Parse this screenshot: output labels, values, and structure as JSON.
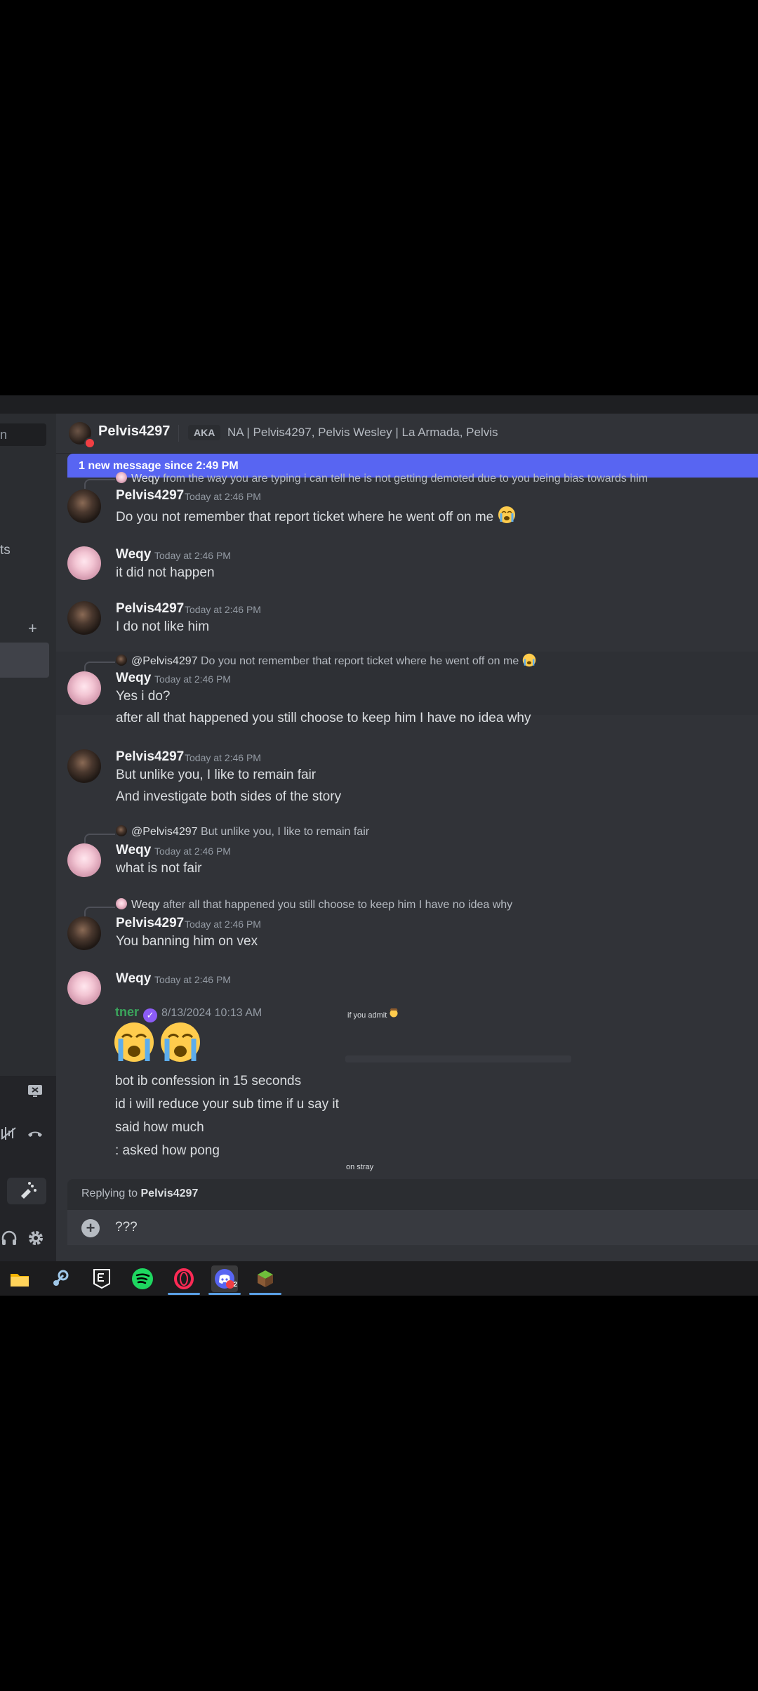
{
  "sidebar": {
    "search_fragment": "n",
    "channel_fragment": "ts",
    "plus_label": "+"
  },
  "header": {
    "name": "Pelvis4297",
    "aka_label": "AKA",
    "aka_names": "NA | Pelvis4297, Pelvis Wesley | La Armada, Pelvis"
  },
  "new_messages_bar": "1 new message since 2:49 PM",
  "messages": [
    {
      "reply_user": "Weqy",
      "reply_text": "from the way you are typing i can tell he is not getting demoted due to you being bias towards him",
      "author": "Pelvis4297",
      "time": "Today at 2:46 PM",
      "text": "Do you not remember that report ticket where he went off on me"
    },
    {
      "author": "Weqy",
      "time": "Today at 2:46 PM",
      "text": "it did not happen"
    },
    {
      "author": "Pelvis4297",
      "time": "Today at 2:46 PM",
      "text": "I do not like him"
    },
    {
      "reply_user": "@Pelvis4297",
      "reply_text": "Do you not remember that report ticket where he went off on me",
      "author": "Weqy",
      "time": "Today at 2:46 PM",
      "text": "Yes i do?",
      "text2": "after all that happened you still choose to keep him I have no idea why"
    },
    {
      "author": "Pelvis4297",
      "time": "Today at 2:46 PM",
      "text": "But unlike you, I like to remain fair",
      "text2": "And investigate both sides of the story"
    },
    {
      "reply_user": "@Pelvis4297",
      "reply_text": "But unlike you, I like to remain fair",
      "author": "Weqy",
      "time": "Today at 2:46 PM",
      "text": "what is not fair"
    },
    {
      "reply_user": "Weqy",
      "reply_text": "after all that happened you still choose to keep him I have no idea why",
      "author": "Pelvis4297",
      "time": "Today at 2:46 PM",
      "text": "You banning him on vex"
    },
    {
      "author": "Weqy",
      "time": "Today at 2:46 PM"
    }
  ],
  "screenshot_embed": {
    "user": "tner",
    "date": "8/13/2024 10:13 AM",
    "side_note": "if you admit",
    "lines": [
      "bot ib confession in 15 seconds",
      "id i will reduce your sub time if u say it",
      "said how much",
      ": asked how pong"
    ],
    "footer": "on stray"
  },
  "reply_bar": {
    "prefix": "Replying to",
    "user": "Pelvis4297"
  },
  "composer": {
    "value": "???"
  },
  "taskbar": {
    "apps": [
      "file-explorer-icon",
      "steam-icon",
      "epic-games-icon",
      "spotify-icon",
      "opera-gx-icon",
      "discord-icon",
      "minecraft-icon"
    ],
    "discord_badge": "2"
  },
  "colors": {
    "accent": "#5865f2",
    "background": "#313338",
    "verified": "#8c5cf6",
    "embed_user": "#3ba55c"
  }
}
